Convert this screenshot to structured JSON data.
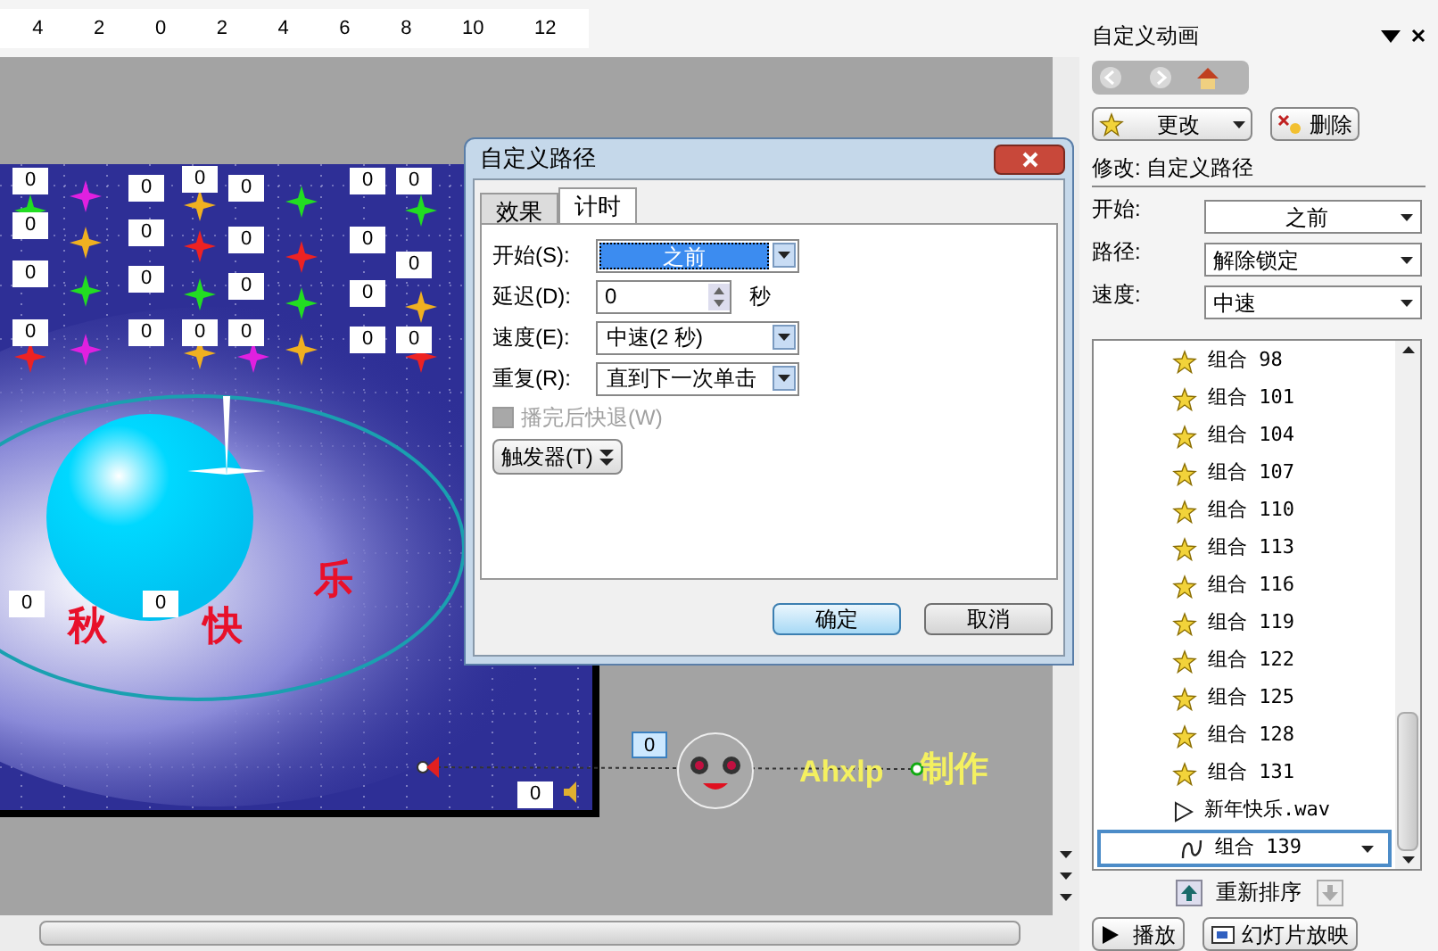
{
  "ruler": {
    "labels": [
      "4",
      "2",
      "0",
      "2",
      "4",
      "6",
      "8",
      "10",
      "12"
    ]
  },
  "slide": {
    "number_labels": [
      "0",
      "0",
      "0",
      "0",
      "0",
      "0",
      "0",
      "0",
      "0",
      "0",
      "0",
      "0",
      "0",
      "0",
      "0",
      "0",
      "0",
      "0",
      "0",
      "0",
      "0",
      "0",
      "0"
    ],
    "title_chars": [
      "秋",
      "快",
      "乐"
    ],
    "sound_label": "0"
  },
  "motion_path": {
    "label": {
      "text": "0",
      "selected": true
    },
    "credit_1": "Ahxlp",
    "credit_2": "制作"
  },
  "dialog": {
    "title": "自定义路径",
    "tabs": [
      {
        "label": "效果",
        "selected": false
      },
      {
        "label": "计时",
        "selected": true
      }
    ],
    "fields": [
      {
        "kind": "dropdown",
        "label": "开始(S):",
        "value": "之前",
        "focused": true
      },
      {
        "kind": "spinner",
        "label": "延迟(D):",
        "value": "0",
        "unit": "秒",
        "focused": false
      },
      {
        "kind": "dropdown",
        "label": "速度(E):",
        "value": "中速(2 秒)",
        "focused": false
      },
      {
        "kind": "dropdown",
        "label": "重复(R):",
        "value": "直到下一次单击",
        "focused": false
      }
    ],
    "rewind": {
      "label": "播完后快退(W)",
      "checked": false,
      "disabled": true
    },
    "trigger_button": "触发器(T)",
    "buttons": [
      {
        "label": "确定",
        "default": true
      },
      {
        "label": "取消",
        "default": false
      }
    ]
  },
  "task_pane": {
    "title": "自定义动画",
    "change_button": "更改",
    "remove_button": "删除",
    "modify": "修改: 自定义路径",
    "settings": [
      {
        "label": "开始:",
        "value": "之前"
      },
      {
        "label": "路径:",
        "value": "解除锁定"
      },
      {
        "label": "速度:",
        "value": "中速"
      }
    ],
    "items": [
      {
        "kind": "star",
        "label": "组合 98",
        "selected": false
      },
      {
        "kind": "star",
        "label": "组合 101",
        "selected": false
      },
      {
        "kind": "star",
        "label": "组合 104",
        "selected": false
      },
      {
        "kind": "star",
        "label": "组合 107",
        "selected": false
      },
      {
        "kind": "star",
        "label": "组合 110",
        "selected": false
      },
      {
        "kind": "star",
        "label": "组合 113",
        "selected": false
      },
      {
        "kind": "star",
        "label": "组合 116",
        "selected": false
      },
      {
        "kind": "star",
        "label": "组合 119",
        "selected": false
      },
      {
        "kind": "star",
        "label": "组合 122",
        "selected": false
      },
      {
        "kind": "star",
        "label": "组合 125",
        "selected": false
      },
      {
        "kind": "star",
        "label": "组合 128",
        "selected": false
      },
      {
        "kind": "star",
        "label": "组合 131",
        "selected": false
      },
      {
        "kind": "sound",
        "label": "新年快乐.wav",
        "selected": false
      },
      {
        "kind": "path",
        "label": "组合 139",
        "selected": true
      }
    ],
    "reorder": "重新排序",
    "play_button": "播放",
    "slideshow_button": "幻灯片放映"
  }
}
